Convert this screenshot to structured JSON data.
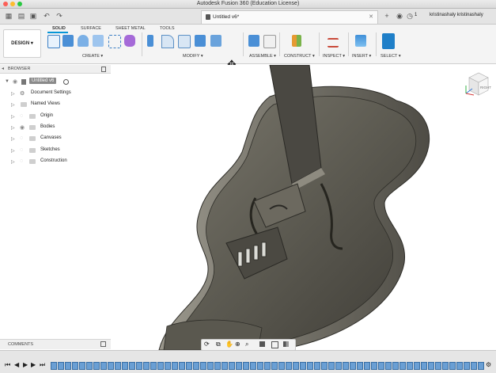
{
  "window": {
    "title": "Autodesk Fusion 360 (Education License)"
  },
  "tabbar": {
    "doc_tab_label": "Untitled v6*",
    "user_name": "kristinashaly kristinashaly",
    "notifications_count": "1"
  },
  "toolbar": {
    "workspace_label": "DESIGN ▾",
    "ws_tabs": [
      "SOLID",
      "SURFACE",
      "SHEET METAL",
      "TOOLS"
    ],
    "groups": [
      "CREATE ▾",
      "MODIFY ▾",
      "ASSEMBLE ▾",
      "CONSTRUCT ▾",
      "INSPECT ▾",
      "INSERT ▾",
      "SELECT ▾"
    ]
  },
  "browser": {
    "header": "BROWSER",
    "root_label": "Untitled v6",
    "items": [
      "Document Settings",
      "Named Views",
      "Origin",
      "Bodies",
      "Canvases",
      "Sketches",
      "Construction"
    ]
  },
  "viewcube": {
    "face_label": "RIGHT"
  },
  "comments": {
    "label": "COMMENTS"
  },
  "colors": {
    "accent": "#0696d7",
    "active_tab_underline": "#0696d7",
    "model_body": "#55534b"
  }
}
